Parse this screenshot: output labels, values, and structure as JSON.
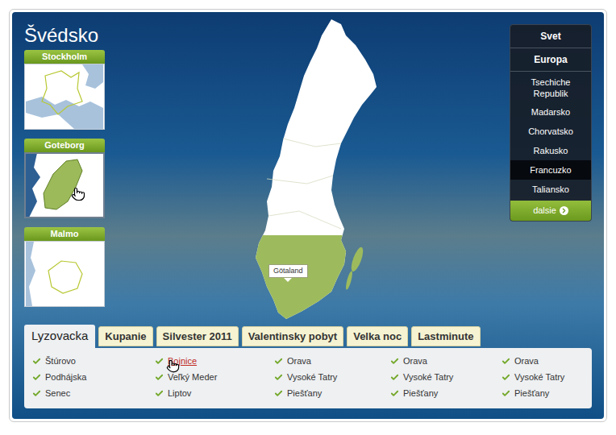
{
  "title": "Švédsko",
  "cities": [
    {
      "name": "Stockholm",
      "selected": false
    },
    {
      "name": "Goteborg",
      "selected": true
    },
    {
      "name": "Malmo",
      "selected": false
    }
  ],
  "map": {
    "region_label": "Götaland"
  },
  "menu": {
    "headers": [
      "Svet",
      "Europa"
    ],
    "items": [
      {
        "label": "Tsechiche Republik",
        "selected": false
      },
      {
        "label": "Madarsko",
        "selected": false
      },
      {
        "label": "Chorvatsko",
        "selected": false
      },
      {
        "label": "Rakusko",
        "selected": false
      },
      {
        "label": "Francuzko",
        "selected": true
      },
      {
        "label": "Taliansko",
        "selected": false
      }
    ],
    "more_button": "dalsie"
  },
  "tabs": [
    {
      "label": "Lyzovacka",
      "selected": true
    },
    {
      "label": "Kupanie",
      "selected": false
    },
    {
      "label": "Silvester 2011",
      "selected": false
    },
    {
      "label": "Valentinsky pobyt",
      "selected": false
    },
    {
      "label": "Velka noc",
      "selected": false
    },
    {
      "label": "Lastminute",
      "selected": false
    }
  ],
  "links": [
    [
      {
        "label": "Štúrovo",
        "hovered": false
      },
      {
        "label": "Podhájska",
        "hovered": false
      },
      {
        "label": "Senec",
        "hovered": false
      }
    ],
    [
      {
        "label": "Bojnice",
        "hovered": true
      },
      {
        "label": "Veľký Meder",
        "hovered": false
      },
      {
        "label": "Liptov",
        "hovered": false
      }
    ],
    [
      {
        "label": "Orava",
        "hovered": false
      },
      {
        "label": "Vysoké Tatry",
        "hovered": false
      },
      {
        "label": "Piešťany",
        "hovered": false
      }
    ],
    [
      {
        "label": "Orava",
        "hovered": false
      },
      {
        "label": "Vysoké Tatry",
        "hovered": false
      },
      {
        "label": "Piešťany",
        "hovered": false
      }
    ],
    [
      {
        "label": "Orava",
        "hovered": false
      },
      {
        "label": "Vysoké Tatry",
        "hovered": false
      },
      {
        "label": "Piešťany",
        "hovered": false
      }
    ]
  ]
}
